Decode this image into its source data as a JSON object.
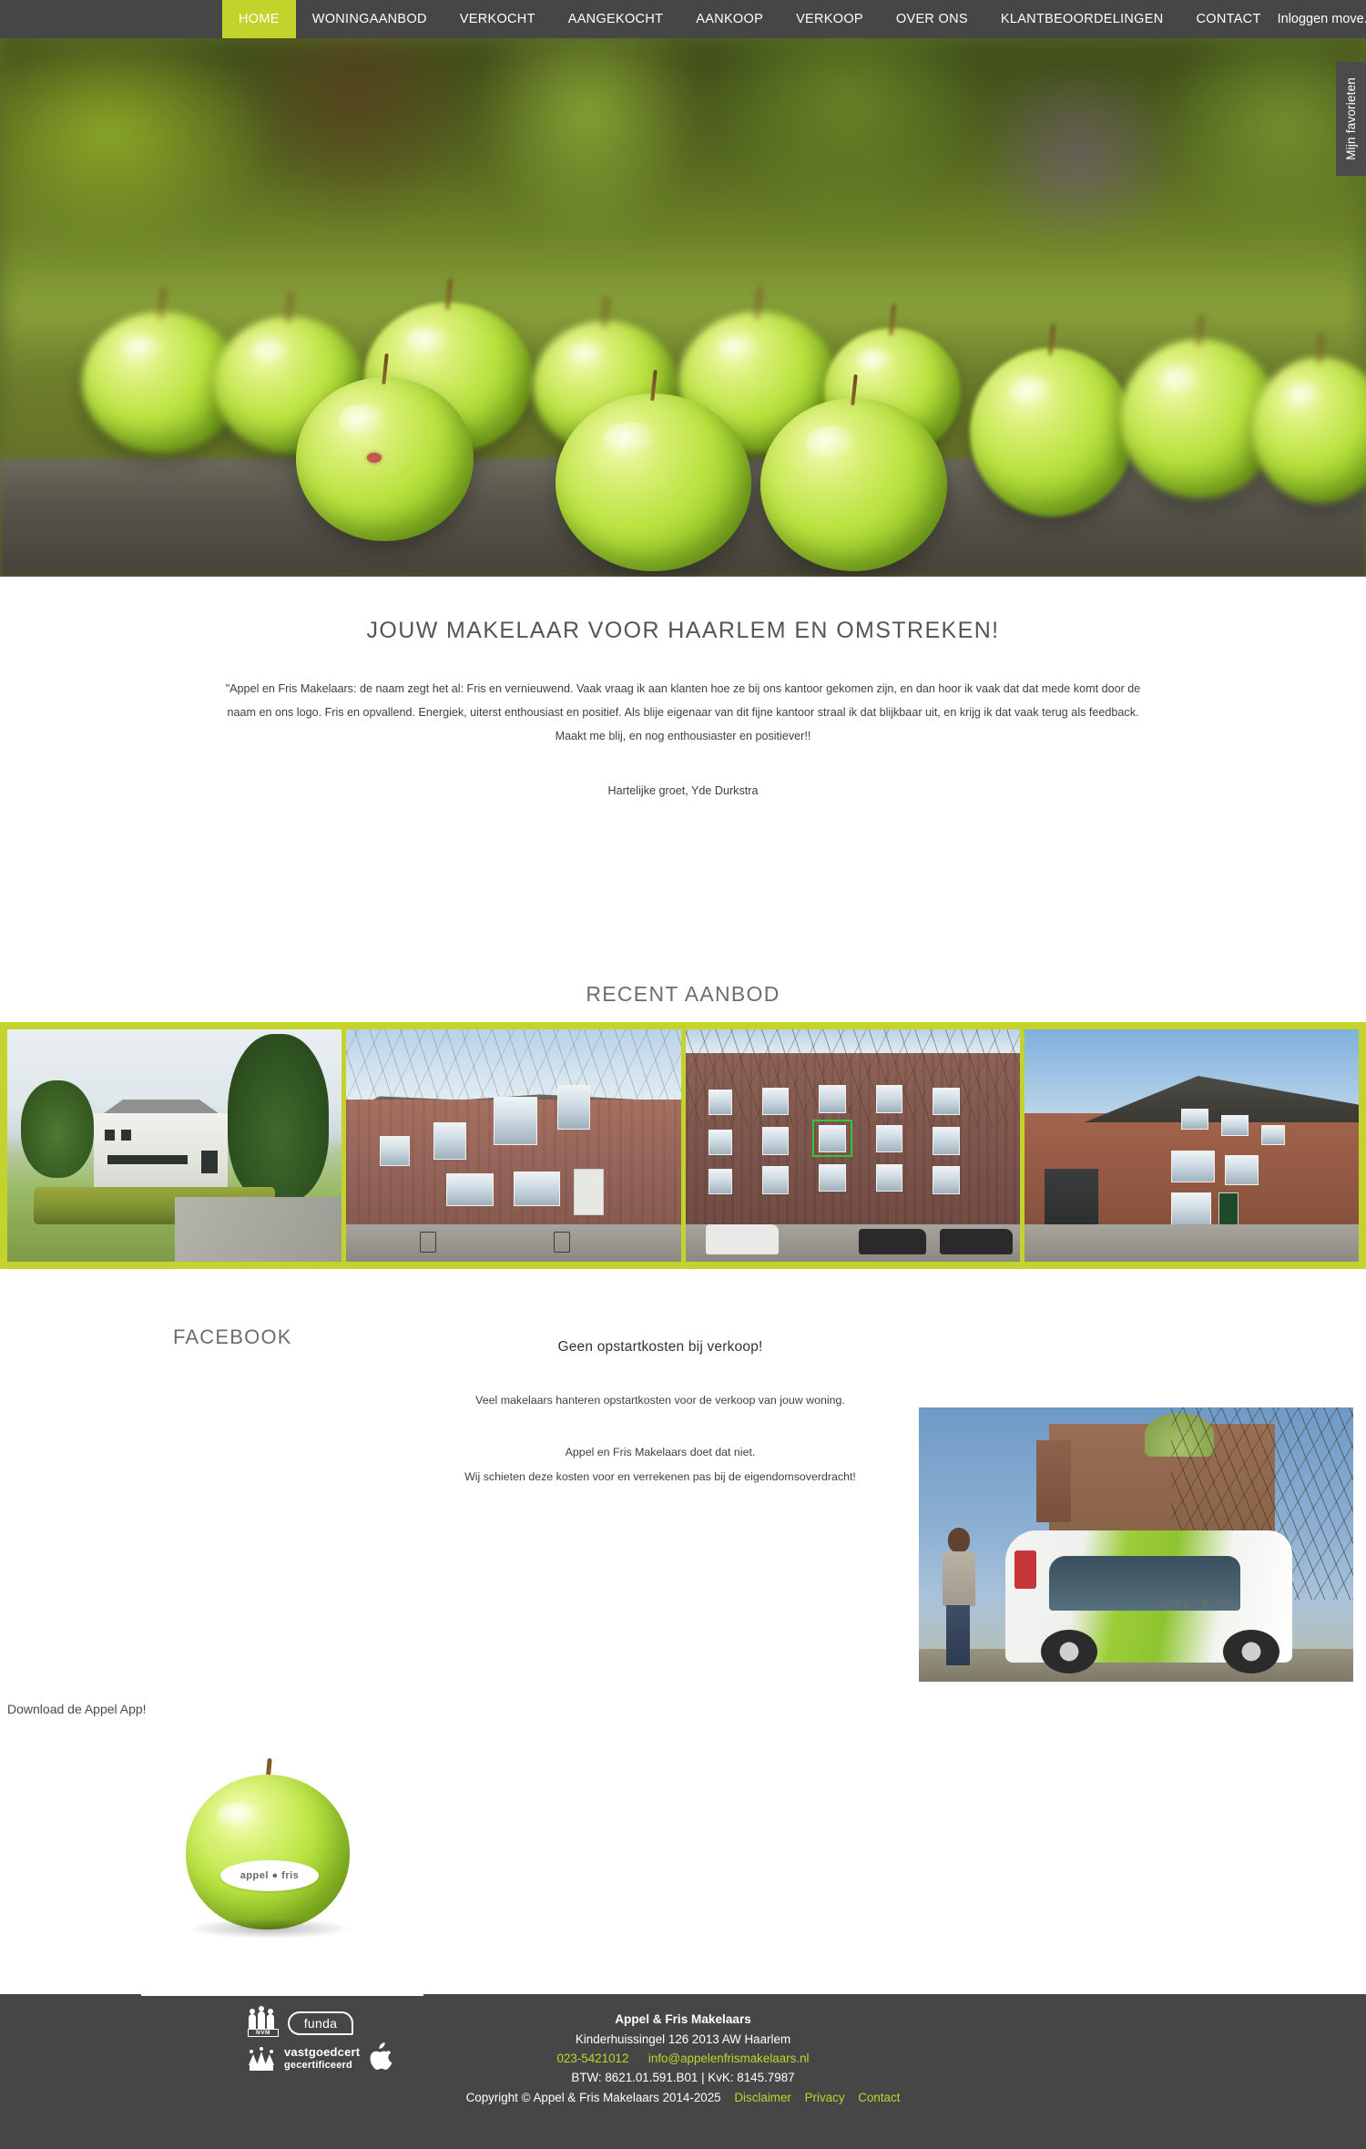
{
  "colors": {
    "accent_green": "#c3d32c",
    "nav_bg": "#464646",
    "footer_bg": "#464646",
    "body_text": "#3f3f3f",
    "heading_text": "#6d6d6d"
  },
  "nav": {
    "items": [
      {
        "label": "HOME",
        "active": true
      },
      {
        "label": "WONINGAANBOD",
        "active": false
      },
      {
        "label": "VERKOCHT",
        "active": false
      },
      {
        "label": "AANGEKOCHT",
        "active": false
      },
      {
        "label": "AANKOOP",
        "active": false
      },
      {
        "label": "VERKOOP",
        "active": false
      },
      {
        "label": "OVER ONS",
        "active": false
      },
      {
        "label": "KLANTBEOORDELINGEN",
        "active": false
      },
      {
        "label": "CONTACT",
        "active": false
      }
    ],
    "login_label": "Inloggen move.nl"
  },
  "hero": {
    "favorites_tab_label": "Mijn favorieten",
    "image_alt": "green-apples-on-table"
  },
  "intro": {
    "heading": "JOUW MAKELAAR VOOR HAARLEM EN OMSTREKEN!",
    "quote": "\"Appel en Fris Makelaars: de naam zegt het al: Fris en vernieuwend. Vaak vraag ik aan klanten hoe ze bij ons kantoor gekomen zijn, en dan hoor ik vaak dat dat mede komt door de naam en ons logo. Fris en opvallend. Energiek, uiterst enthousiast en positief. Als blije eigenaar van dit fijne kantoor straal ik dat blijkbaar uit, en krijg ik dat vaak terug als feedback. Maakt me blij, en nog enthousiaster en positiever!!",
    "signature": "Hartelijke groet, Yde Durkstra"
  },
  "recent": {
    "title": "RECENT AANBOD",
    "cards": [
      {
        "alt": "white-villa-with-hedge"
      },
      {
        "alt": "brick-townhouse-street"
      },
      {
        "alt": "canal-apartment-building"
      },
      {
        "alt": "brick-corner-house"
      }
    ]
  },
  "facebook": {
    "title": "FACEBOOK"
  },
  "promo": {
    "heading": "Geen opstartkosten bij verkoop!",
    "line1": "Veel makelaars hanteren opstartkosten voor de verkoop van jouw woning.",
    "line2": "Appel en Fris Makelaars doet dat niet.",
    "line3": "Wij schieten deze kosten voor en verrekenen pas bij de eigendomsoverdracht!",
    "photo_alt": "appel-en-fris-company-car-haarlem",
    "car_logo_text": "appel ● fris"
  },
  "app": {
    "download_label": "Download de Appel App!",
    "apple_sticker_text": "appel ● fris",
    "image_alt": "green-apple-with-appel-fris-sticker"
  },
  "footer": {
    "logos": [
      {
        "name": "nvm-logo",
        "label": "NVM"
      },
      {
        "name": "funda-logo",
        "label": "funda"
      },
      {
        "name": "vastgoedcert-logo",
        "label_line1": "vastgoedcert",
        "label_line2": "gecertificeerd"
      },
      {
        "name": "apple-logo",
        "glyph": ""
      }
    ],
    "company_name": "Appel & Fris Makelaars",
    "address": "Kinderhuissingel 126   2013 AW Haarlem",
    "phone": "023-5421012",
    "email": "info@appelenfrismakelaars.nl",
    "btw_kvk": "BTW: 8621.01.591.B01 | KvK: 8145.7987",
    "copyright": "Copyright © Appel & Fris Makelaars 2014-2025",
    "links": [
      {
        "label": "Disclaimer"
      },
      {
        "label": "Privacy"
      },
      {
        "label": "Contact"
      }
    ]
  }
}
